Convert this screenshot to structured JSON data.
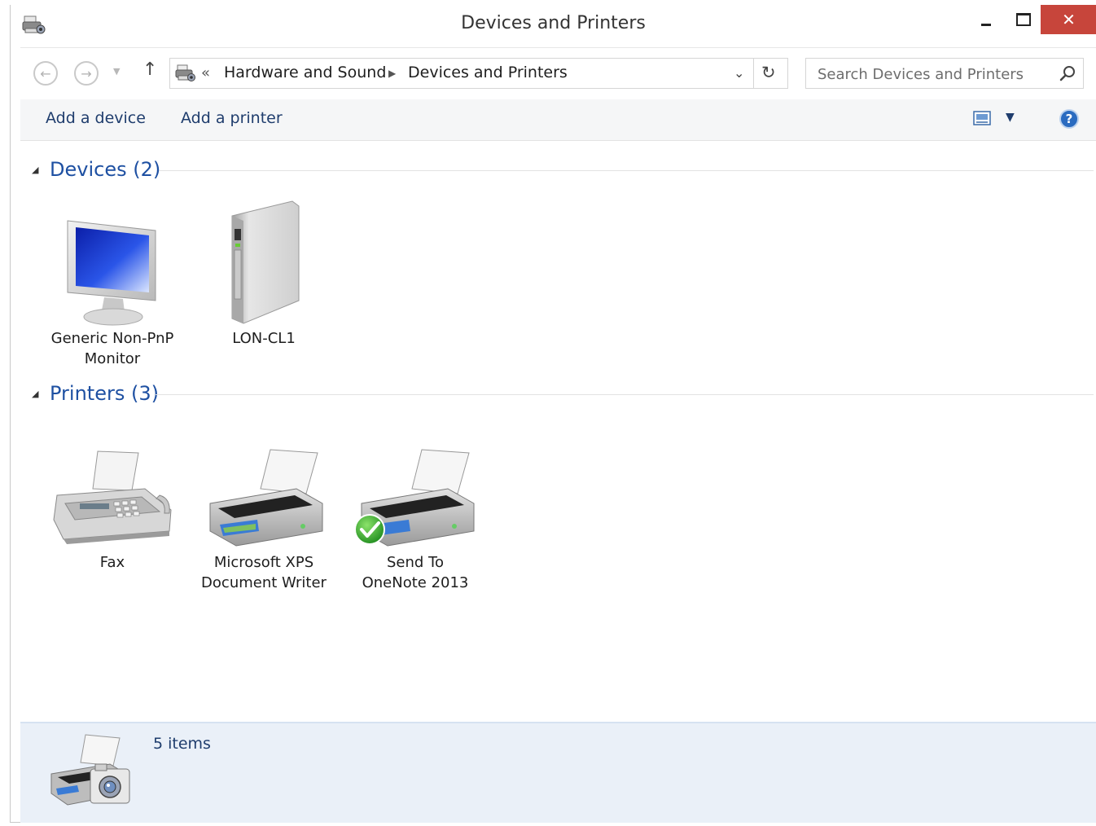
{
  "window": {
    "title": "Devices and Printers",
    "close_label": "✕"
  },
  "nav": {
    "breadcrumb": [
      "Hardware and Sound",
      "Devices and Printers"
    ],
    "search_placeholder": "Search Devices and Printers"
  },
  "commands": {
    "add_device": "Add a device",
    "add_printer": "Add a printer",
    "help_label": "?"
  },
  "groups": [
    {
      "title": "Devices (2)",
      "items": [
        {
          "label": "Generic Non-PnP\nMonitor",
          "icon": "monitor-icon"
        },
        {
          "label": "LON-CL1",
          "icon": "computer-tower-icon"
        }
      ]
    },
    {
      "title": "Printers (3)",
      "items": [
        {
          "label": "Fax",
          "icon": "fax-icon"
        },
        {
          "label": "Microsoft XPS\nDocument Writer",
          "icon": "printer-icon"
        },
        {
          "label": "Send To\nOneNote 2013",
          "icon": "printer-default-icon",
          "default": true
        }
      ]
    }
  ],
  "details": {
    "count": "5 items"
  },
  "colors": {
    "accent": "#1e50a2",
    "close": "#c7453b",
    "details_bg": "#eaf0f8"
  }
}
